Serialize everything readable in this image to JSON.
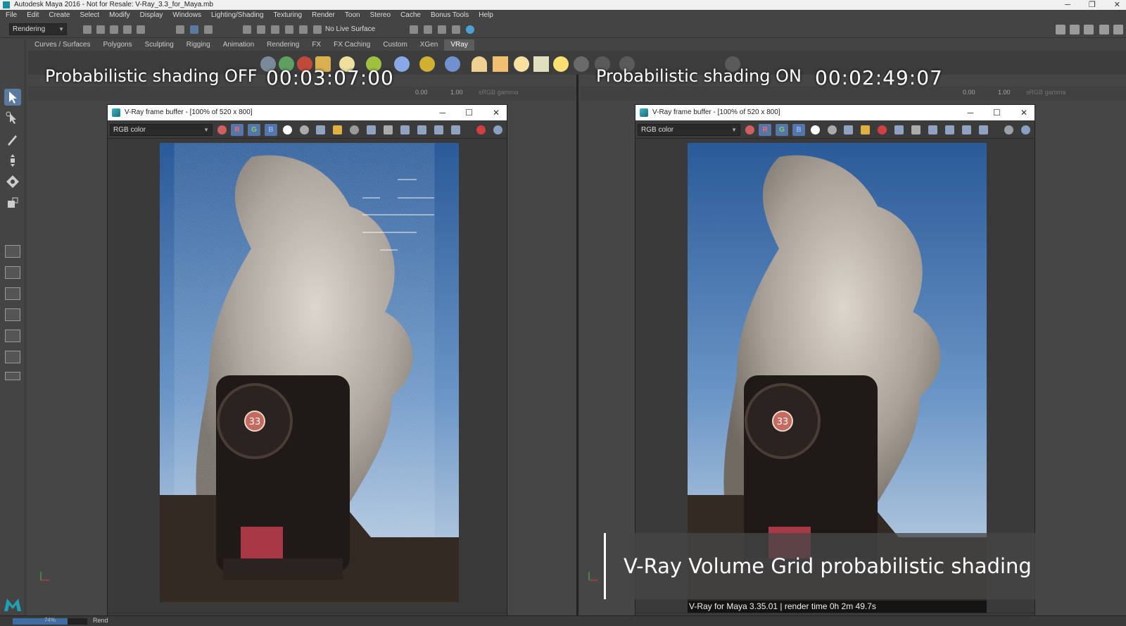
{
  "window": {
    "title": "Autodesk Maya 2016 - Not for Resale: V-Ray_3.3_for_Maya.mb"
  },
  "menu": [
    "File",
    "Edit",
    "Create",
    "Select",
    "Modify",
    "Display",
    "Windows",
    "Lighting/Shading",
    "Texturing",
    "Render",
    "Toon",
    "Stereo",
    "Cache",
    "Bonus Tools",
    "Help"
  ],
  "status_line": {
    "mode": "Rendering",
    "live_surface": "No Live Surface"
  },
  "shelf_tabs": [
    "Curves / Surfaces",
    "Polygons",
    "Sculpting",
    "Rigging",
    "Animation",
    "Rendering",
    "FX",
    "FX Caching",
    "Custom",
    "XGen",
    "VRay"
  ],
  "active_shelf_tab": "VRay",
  "viewport_left": {
    "overlay_label": "Probabilistic shading OFF",
    "render_time": "00:03:07:00",
    "exposure": "0.00",
    "gamma_value": "1.00",
    "color_space": "sRGB gamma"
  },
  "viewport_right": {
    "overlay_label": "Probabilistic shading ON",
    "render_time": "00:02:49:07",
    "exposure": "0.00",
    "gamma_value": "1.00",
    "color_space": "sRGB gamma"
  },
  "vfb_left": {
    "title": "V-Ray frame buffer - [100% of 520 x 800]",
    "channel": "RGB color",
    "channels": [
      "R",
      "G",
      "B"
    ],
    "engine_number": "33"
  },
  "vfb_right": {
    "title": "V-Ray frame buffer - [100% of 520 x 800]",
    "channel": "RGB color",
    "channels": [
      "R",
      "G",
      "B"
    ],
    "engine_number": "33",
    "render_info": "V-Ray for Maya 3.35.01 | render time  0h  2m 49.7s"
  },
  "caption": "V-Ray Volume Grid probabilistic shading",
  "bottom_status": {
    "progress_percent": 74,
    "progress_label": "74%",
    "label": "Rend"
  },
  "colors": {
    "accent": "#5d5d5d",
    "channel_button": "#5675a8",
    "ui_bg": "#444444"
  }
}
